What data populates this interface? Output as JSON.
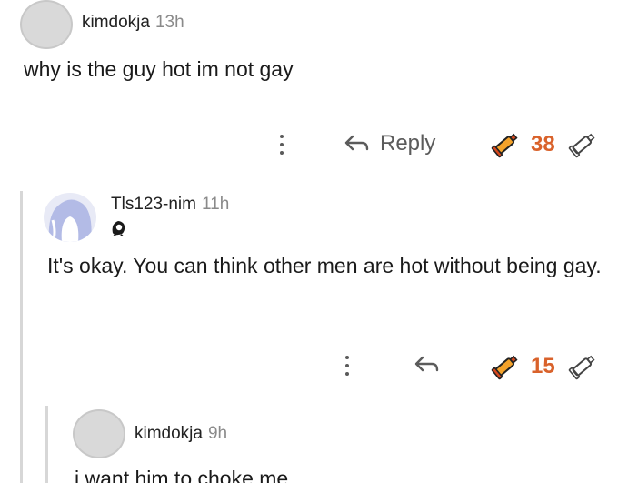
{
  "comments": [
    {
      "username": "kimdokja",
      "time": "13h",
      "body": "why is the guy hot im not gay",
      "reply_label": "Reply",
      "votes": "38"
    },
    {
      "username": "Tls123-nim",
      "time": "11h",
      "body": "It's okay. You can think other men are hot without being gay.",
      "votes": "15"
    },
    {
      "username": "kimdokja",
      "time": "9h",
      "body": "i want him to choke me"
    }
  ]
}
